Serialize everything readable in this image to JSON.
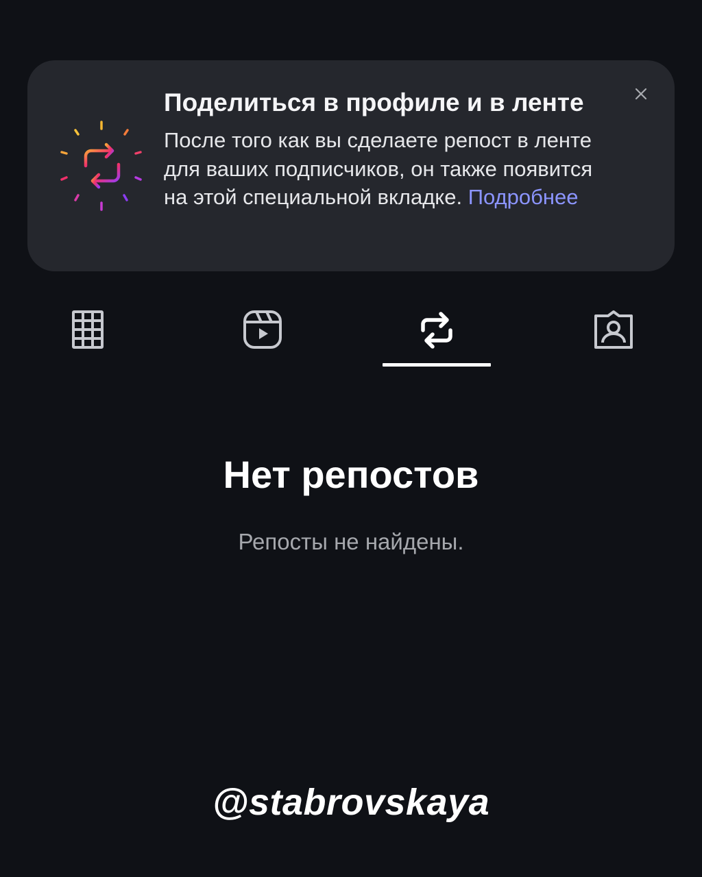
{
  "info_card": {
    "title": "Поделиться в профиле и в ленте",
    "body": "После того как вы сделаете репост в ленте для ваших подписчиков, он также появится на этой специальной вкладке.",
    "link_label": "Подробнее",
    "icon": "repost-sparkle-icon",
    "close_icon": "close-icon",
    "link_color": "#8c95ff"
  },
  "tabs": {
    "items": [
      {
        "name": "grid-icon",
        "selected": false
      },
      {
        "name": "reels-icon",
        "selected": false
      },
      {
        "name": "repost-icon",
        "selected": true
      },
      {
        "name": "tagged-icon",
        "selected": false
      }
    ]
  },
  "empty_state": {
    "title": "Нет репостов",
    "subtitle": "Репосты не найдены."
  },
  "watermark": {
    "text": "@stabrovskaya"
  },
  "colors": {
    "background": "#0f1116",
    "card": "#25272d",
    "icon_gray": "#c7c9cf",
    "subtitle": "#a6a8ad"
  }
}
